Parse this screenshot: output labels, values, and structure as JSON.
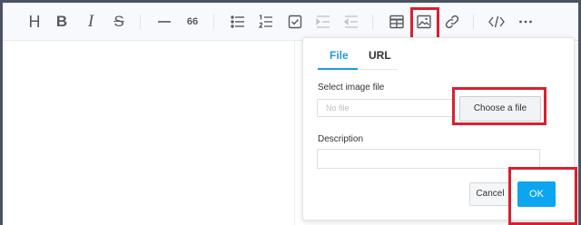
{
  "toolbar": {
    "items": [
      {
        "name": "heading",
        "icon": "heading-icon",
        "glyph": "H"
      },
      {
        "name": "bold",
        "icon": "bold-icon",
        "glyph": "B"
      },
      {
        "name": "italic",
        "icon": "italic-icon",
        "glyph": "I"
      },
      {
        "name": "strikethrough",
        "icon": "strikethrough-icon",
        "glyph": "S"
      },
      {
        "name": "horizontal-rule",
        "icon": "horizontal-rule-icon"
      },
      {
        "name": "quote",
        "icon": "quote-icon",
        "glyph": "66"
      },
      {
        "name": "bullet-list",
        "icon": "bullet-list-icon"
      },
      {
        "name": "ordered-list",
        "icon": "ordered-list-icon"
      },
      {
        "name": "task-list",
        "icon": "task-list-icon"
      },
      {
        "name": "indent",
        "icon": "indent-icon",
        "disabled": true
      },
      {
        "name": "outdent",
        "icon": "outdent-icon",
        "disabled": true
      },
      {
        "name": "table",
        "icon": "table-icon"
      },
      {
        "name": "image",
        "icon": "image-icon",
        "highlighted": true
      },
      {
        "name": "link",
        "icon": "link-icon"
      },
      {
        "name": "code-block",
        "icon": "code-icon"
      },
      {
        "name": "more",
        "icon": "more-icon"
      }
    ]
  },
  "popup": {
    "tabs": [
      {
        "label": "File",
        "active": true
      },
      {
        "label": "URL",
        "active": false
      }
    ],
    "select_label": "Select image file",
    "file_placeholder": "No file",
    "choose_button": "Choose a file",
    "description_label": "Description",
    "description_value": "",
    "cancel_button": "Cancel",
    "ok_button": "OK"
  },
  "colors": {
    "accent": "#1f9bde",
    "ok_button": "#0ca5f0",
    "highlight_annotation": "#d9202f",
    "page_background": "#4a5361"
  }
}
